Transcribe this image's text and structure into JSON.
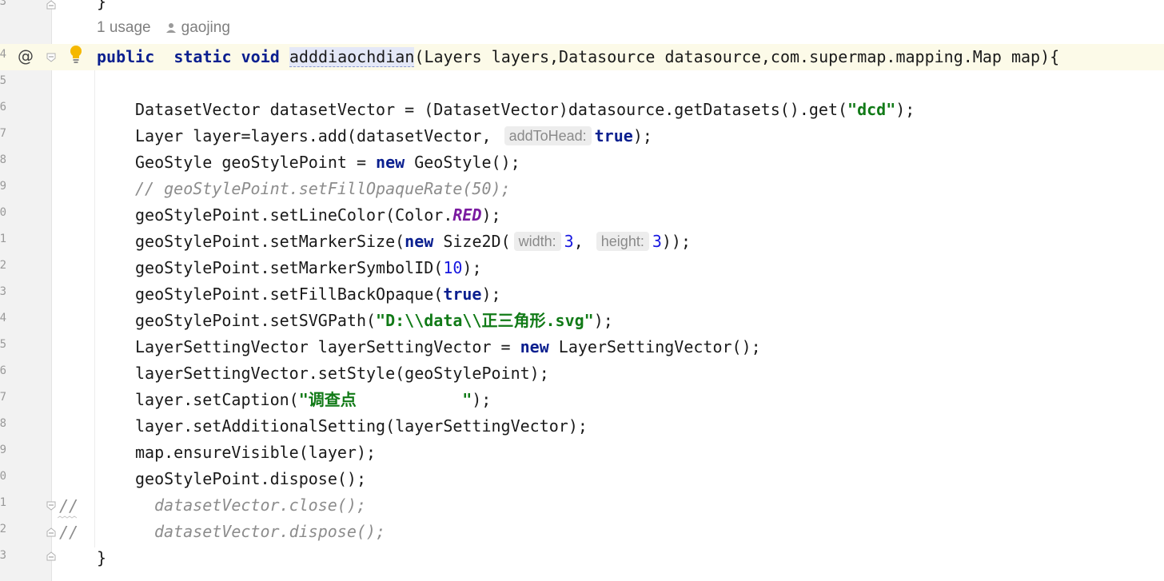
{
  "editor": {
    "line_numbers": [
      "3",
      "4",
      "5",
      "6",
      "7",
      "8",
      "9",
      "0",
      "1",
      "2",
      "3",
      "4",
      "5",
      "6",
      "7",
      "8",
      "9",
      "0",
      "1",
      "2",
      "3"
    ],
    "usage_text": "1 usage",
    "author": "gaojing",
    "at_symbol": "@",
    "comment_prefix": "//",
    "lines": {
      "l0": {
        "brace": "}"
      },
      "l1": {
        "kw_public": "public",
        "kw_static": "static",
        "kw_void": "void",
        "method": "adddiaochdian",
        "rest": "(Layers layers,Datasource datasource,com.supermap.mapping.Map map){"
      },
      "l3": {
        "a": "DatasetVector datasetVector = (DatasetVector)datasource.getDatasets().get(",
        "str": "\"dcd\"",
        "b": ");"
      },
      "l4": {
        "a": "Layer layer=layers.add(datasetVector, ",
        "hint": "addToHead:",
        "kw": "true",
        "b": ");"
      },
      "l5": {
        "a": "GeoStyle geoStylePoint = ",
        "kw": "new",
        "b": " GeoStyle();"
      },
      "l6": {
        "cmt": "// geoStylePoint.setFillOpaqueRate(50);"
      },
      "l7": {
        "a": "geoStylePoint.setLineColor(Color.",
        "field": "RED",
        "b": ");"
      },
      "l8": {
        "a": "geoStylePoint.setMarkerSize(",
        "kw": "new",
        "b": " Size2D(",
        "hint1": "width:",
        "n1": "3",
        "c": ",",
        "hint2": "height:",
        "n2": "3",
        "d": "));"
      },
      "l9": {
        "a": "geoStylePoint.setMarkerSymbolID(",
        "num": "10",
        "b": ");"
      },
      "l10": {
        "a": "geoStylePoint.setFillBackOpaque(",
        "kw": "true",
        "b": ");"
      },
      "l11": {
        "a": "geoStylePoint.setSVGPath(",
        "str": "\"D:\\\\data\\\\正三角形.svg\"",
        "b": ");"
      },
      "l12": {
        "a": "LayerSettingVector layerSettingVector = ",
        "kw": "new",
        "b": " LayerSettingVector();"
      },
      "l13": {
        "a": "layerSettingVector.setStyle(geoStylePoint);"
      },
      "l14": {
        "a": "layer.setCaption(",
        "str": "\"调查点           \"",
        "b": ");"
      },
      "l15": {
        "a": "layer.setAdditionalSetting(layerSettingVector);"
      },
      "l16": {
        "a": "map.ensureVisible(layer);"
      },
      "l17": {
        "a": "geoStylePoint.dispose();"
      },
      "l18": {
        "cmt": "datasetVector.close();"
      },
      "l19": {
        "cmt": "datasetVector.dispose();"
      },
      "l20": {
        "brace": "}"
      }
    }
  }
}
